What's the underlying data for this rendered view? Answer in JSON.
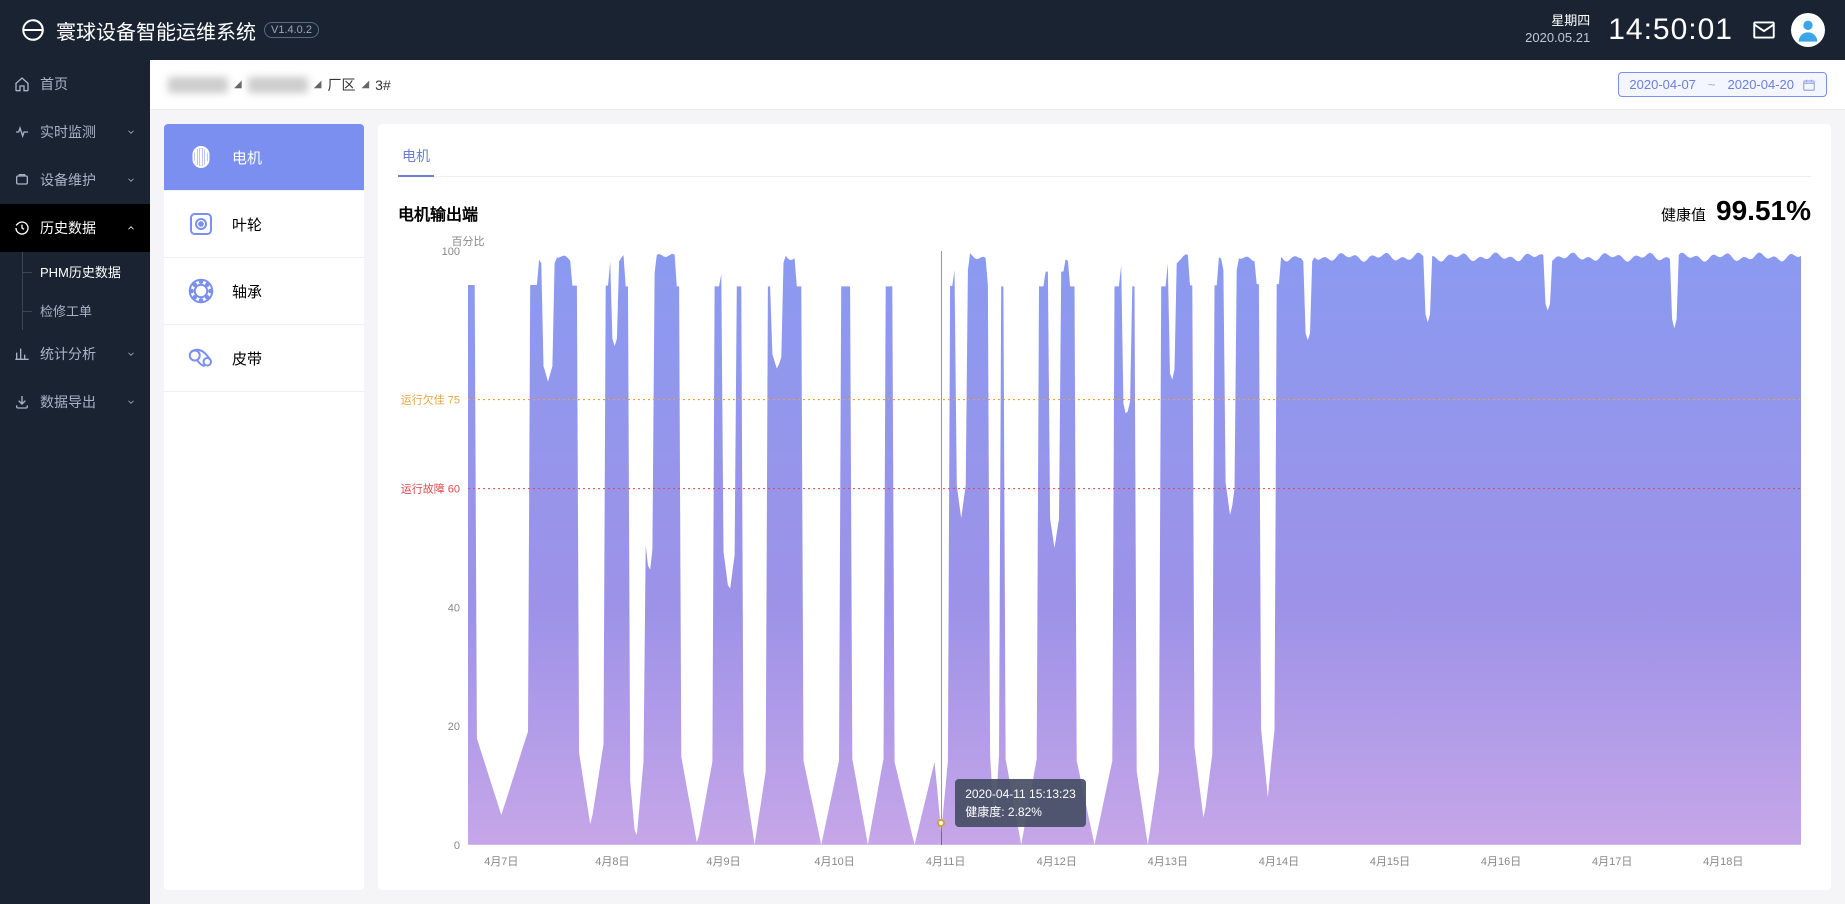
{
  "header": {
    "app_title": "寰球设备智能运维系统",
    "version": "V1.4.0.2",
    "day_of_week": "星期四",
    "date": "2020.05.21",
    "time": "14:50:01"
  },
  "sidebar": {
    "items": [
      {
        "icon": "home",
        "label": "首页",
        "expandable": false
      },
      {
        "icon": "monitor",
        "label": "实时监测",
        "expandable": true
      },
      {
        "icon": "maintain",
        "label": "设备维护",
        "expandable": true
      },
      {
        "icon": "history",
        "label": "历史数据",
        "expandable": true,
        "active": true,
        "children": [
          {
            "label": "PHM历史数据",
            "current": true
          },
          {
            "label": "检修工单"
          }
        ]
      },
      {
        "icon": "stats",
        "label": "统计分析",
        "expandable": true
      },
      {
        "icon": "export",
        "label": "数据导出",
        "expandable": true
      }
    ]
  },
  "breadcrumb": {
    "parts": [
      "",
      "",
      "厂区",
      "3#"
    ],
    "blurred": [
      true,
      true,
      false,
      false
    ]
  },
  "date_range": {
    "from": "2020-04-07",
    "to": "2020-04-20"
  },
  "components": [
    {
      "key": "motor",
      "label": "电机",
      "selected": true
    },
    {
      "key": "impeller",
      "label": "叶轮"
    },
    {
      "key": "bearing",
      "label": "轴承"
    },
    {
      "key": "belt",
      "label": "皮带"
    }
  ],
  "chart_tabs": [
    {
      "label": "电机",
      "active": true
    }
  ],
  "chart": {
    "title": "电机输出端",
    "health_label": "健康值",
    "health_value": "99.51%",
    "tooltip": {
      "timestamp": "2020-04-11 15:13:23",
      "metric_label": "健康度",
      "metric_value": "2.82%"
    }
  },
  "chart_data": {
    "type": "area",
    "y_unit": "百分比",
    "ylim": [
      0,
      100
    ],
    "y_ticks": [
      0,
      20,
      40,
      100
    ],
    "reference_lines": [
      {
        "label": "运行欠佳",
        "value": 75,
        "color": "#e8a23c"
      },
      {
        "label": "运行故障",
        "value": 60,
        "color": "#e04848"
      }
    ],
    "x_ticks": [
      "4月7日",
      "4月8日",
      "4月9日",
      "4月10日",
      "4月11日",
      "4月12日",
      "4月13日",
      "4月14日",
      "4月15日",
      "4月16日",
      "4月17日",
      "4月18日"
    ],
    "series": [
      {
        "name": "健康度",
        "baseline": 99,
        "dips": [
          {
            "x_frac": 0.025,
            "low": 5,
            "width": 0.02
          },
          {
            "x_frac": 0.06,
            "low": 78,
            "width": 0.004
          },
          {
            "x_frac": 0.092,
            "low": 3,
            "width": 0.01
          },
          {
            "x_frac": 0.11,
            "low": 84,
            "width": 0.003
          },
          {
            "x_frac": 0.126,
            "low": 0,
            "width": 0.006
          },
          {
            "x_frac": 0.136,
            "low": 45,
            "width": 0.004
          },
          {
            "x_frac": 0.172,
            "low": 0,
            "width": 0.012
          },
          {
            "x_frac": 0.196,
            "low": 42,
            "width": 0.005
          },
          {
            "x_frac": 0.215,
            "low": 0,
            "width": 0.01
          },
          {
            "x_frac": 0.232,
            "low": 80,
            "width": 0.004
          },
          {
            "x_frac": 0.265,
            "low": 0,
            "width": 0.014
          },
          {
            "x_frac": 0.3,
            "low": 0,
            "width": 0.012
          },
          {
            "x_frac": 0.335,
            "low": 0,
            "width": 0.016
          },
          {
            "x_frac": 0.355,
            "low": 2,
            "width": 0.006
          },
          {
            "x_frac": 0.37,
            "low": 55,
            "width": 0.004
          },
          {
            "x_frac": 0.395,
            "low": 3,
            "width": 0.004
          },
          {
            "x_frac": 0.415,
            "low": 0,
            "width": 0.012
          },
          {
            "x_frac": 0.44,
            "low": 50,
            "width": 0.005
          },
          {
            "x_frac": 0.47,
            "low": 0,
            "width": 0.014
          },
          {
            "x_frac": 0.494,
            "low": 72,
            "width": 0.004
          },
          {
            "x_frac": 0.51,
            "low": 0,
            "width": 0.01
          },
          {
            "x_frac": 0.528,
            "low": 78,
            "width": 0.003
          },
          {
            "x_frac": 0.552,
            "low": 4,
            "width": 0.008
          },
          {
            "x_frac": 0.572,
            "low": 55,
            "width": 0.004
          },
          {
            "x_frac": 0.6,
            "low": 8,
            "width": 0.006
          },
          {
            "x_frac": 0.63,
            "low": 85,
            "width": 0.003
          },
          {
            "x_frac": 0.72,
            "low": 88,
            "width": 0.002
          },
          {
            "x_frac": 0.81,
            "low": 90,
            "width": 0.002
          },
          {
            "x_frac": 0.905,
            "low": 87,
            "width": 0.002
          }
        ]
      }
    ],
    "crosshair_x_frac": 0.355
  }
}
